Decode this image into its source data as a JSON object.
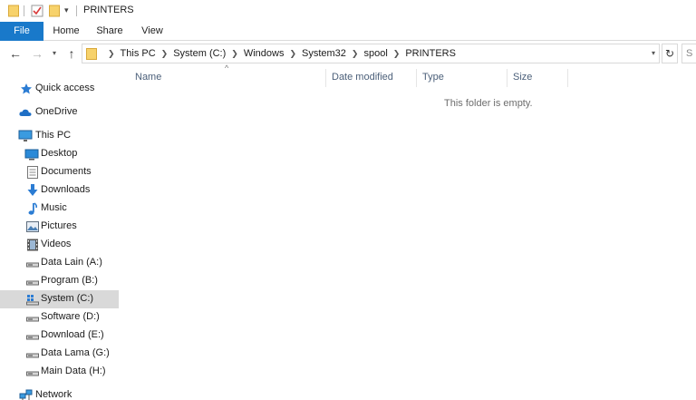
{
  "window": {
    "title": "PRINTERS"
  },
  "ribbon": {
    "tabs": [
      {
        "label": "File"
      },
      {
        "label": "Home"
      },
      {
        "label": "Share"
      },
      {
        "label": "View"
      }
    ]
  },
  "address": {
    "crumbs": [
      "This PC",
      "System (C:)",
      "Windows",
      "System32",
      "spool",
      "PRINTERS"
    ],
    "search_placeholder": "S"
  },
  "nav": {
    "items": [
      {
        "label": "Quick access"
      },
      {
        "label": "OneDrive"
      },
      {
        "label": "This PC"
      },
      {
        "label": "Desktop"
      },
      {
        "label": "Documents"
      },
      {
        "label": "Downloads"
      },
      {
        "label": "Music"
      },
      {
        "label": "Pictures"
      },
      {
        "label": "Videos"
      },
      {
        "label": "Data Lain (A:)"
      },
      {
        "label": "Program (B:)"
      },
      {
        "label": "System (C:)"
      },
      {
        "label": "Software (D:)"
      },
      {
        "label": "Download (E:)"
      },
      {
        "label": "Data Lama (G:)"
      },
      {
        "label": "Main Data (H:)"
      },
      {
        "label": "Network"
      }
    ],
    "selected": "System (C:)"
  },
  "content": {
    "columns": [
      {
        "label": "Name"
      },
      {
        "label": "Date modified"
      },
      {
        "label": "Type"
      },
      {
        "label": "Size"
      }
    ],
    "empty_message": "This folder is empty."
  },
  "colors": {
    "accent": "#1979ca",
    "selected_bg": "#d9d9d9",
    "folder_yellow": "#f7d26b",
    "header_text": "#4c607a"
  }
}
